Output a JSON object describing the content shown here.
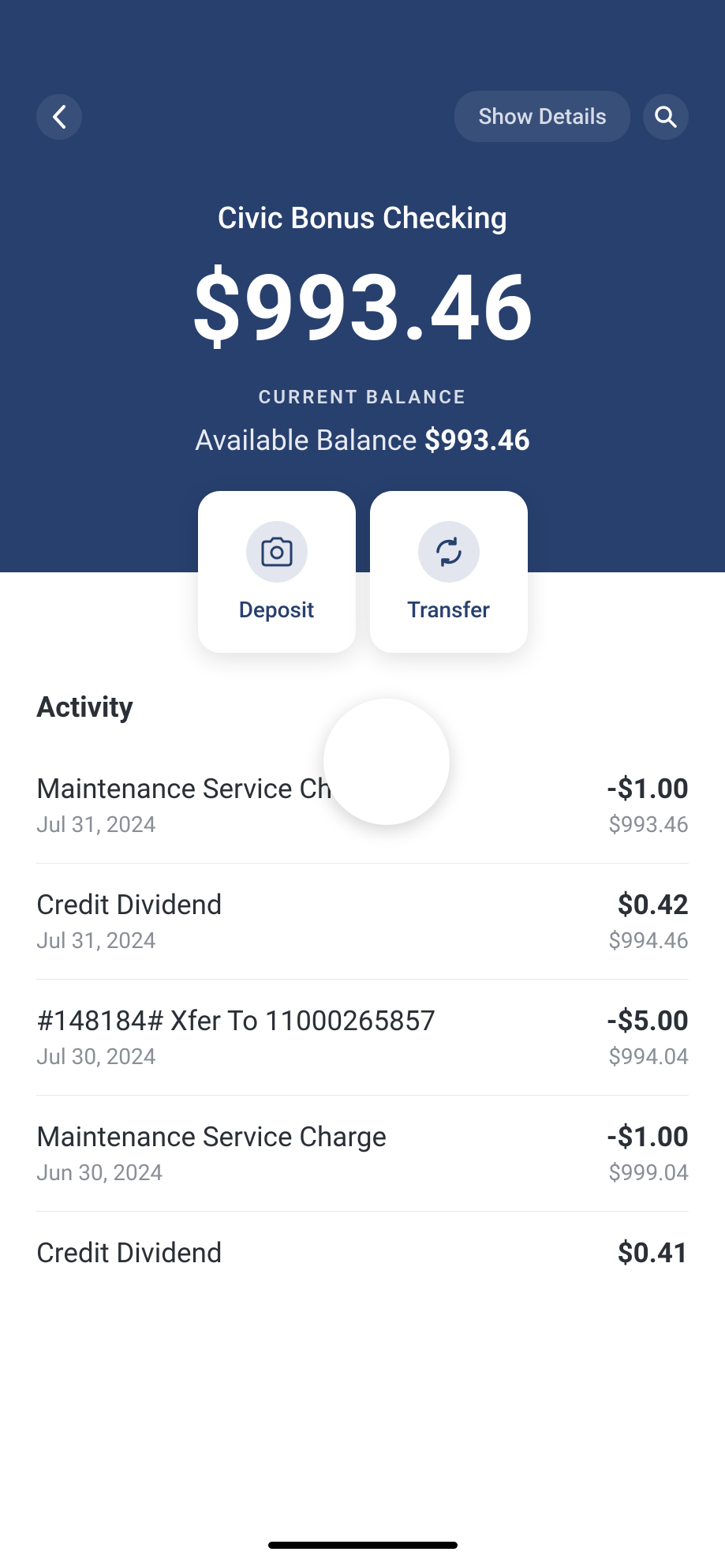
{
  "header": {
    "show_details": "Show Details",
    "account_name": "Civic Bonus Checking",
    "balance": "$993.46",
    "balance_label": "CURRENT BALANCE",
    "available_label": "Available Balance",
    "available_amount": "$993.46"
  },
  "actions": {
    "deposit": "Deposit",
    "transfer": "Transfer"
  },
  "activity": {
    "title": "Activity",
    "transactions": [
      {
        "desc": "Maintenance Service Charge",
        "date": "Jul 31, 2024",
        "amount": "-$1.00",
        "balance": "$993.46"
      },
      {
        "desc": "Credit Dividend",
        "date": "Jul 31, 2024",
        "amount": "$0.42",
        "balance": "$994.46"
      },
      {
        "desc": "#148184# Xfer To 11000265857",
        "date": "Jul 30, 2024",
        "amount": "-$5.00",
        "balance": "$994.04"
      },
      {
        "desc": "Maintenance Service Charge",
        "date": "Jun 30, 2024",
        "amount": "-$1.00",
        "balance": "$999.04"
      },
      {
        "desc": "Credit Dividend",
        "date": "",
        "amount": "$0.41",
        "balance": ""
      }
    ]
  }
}
